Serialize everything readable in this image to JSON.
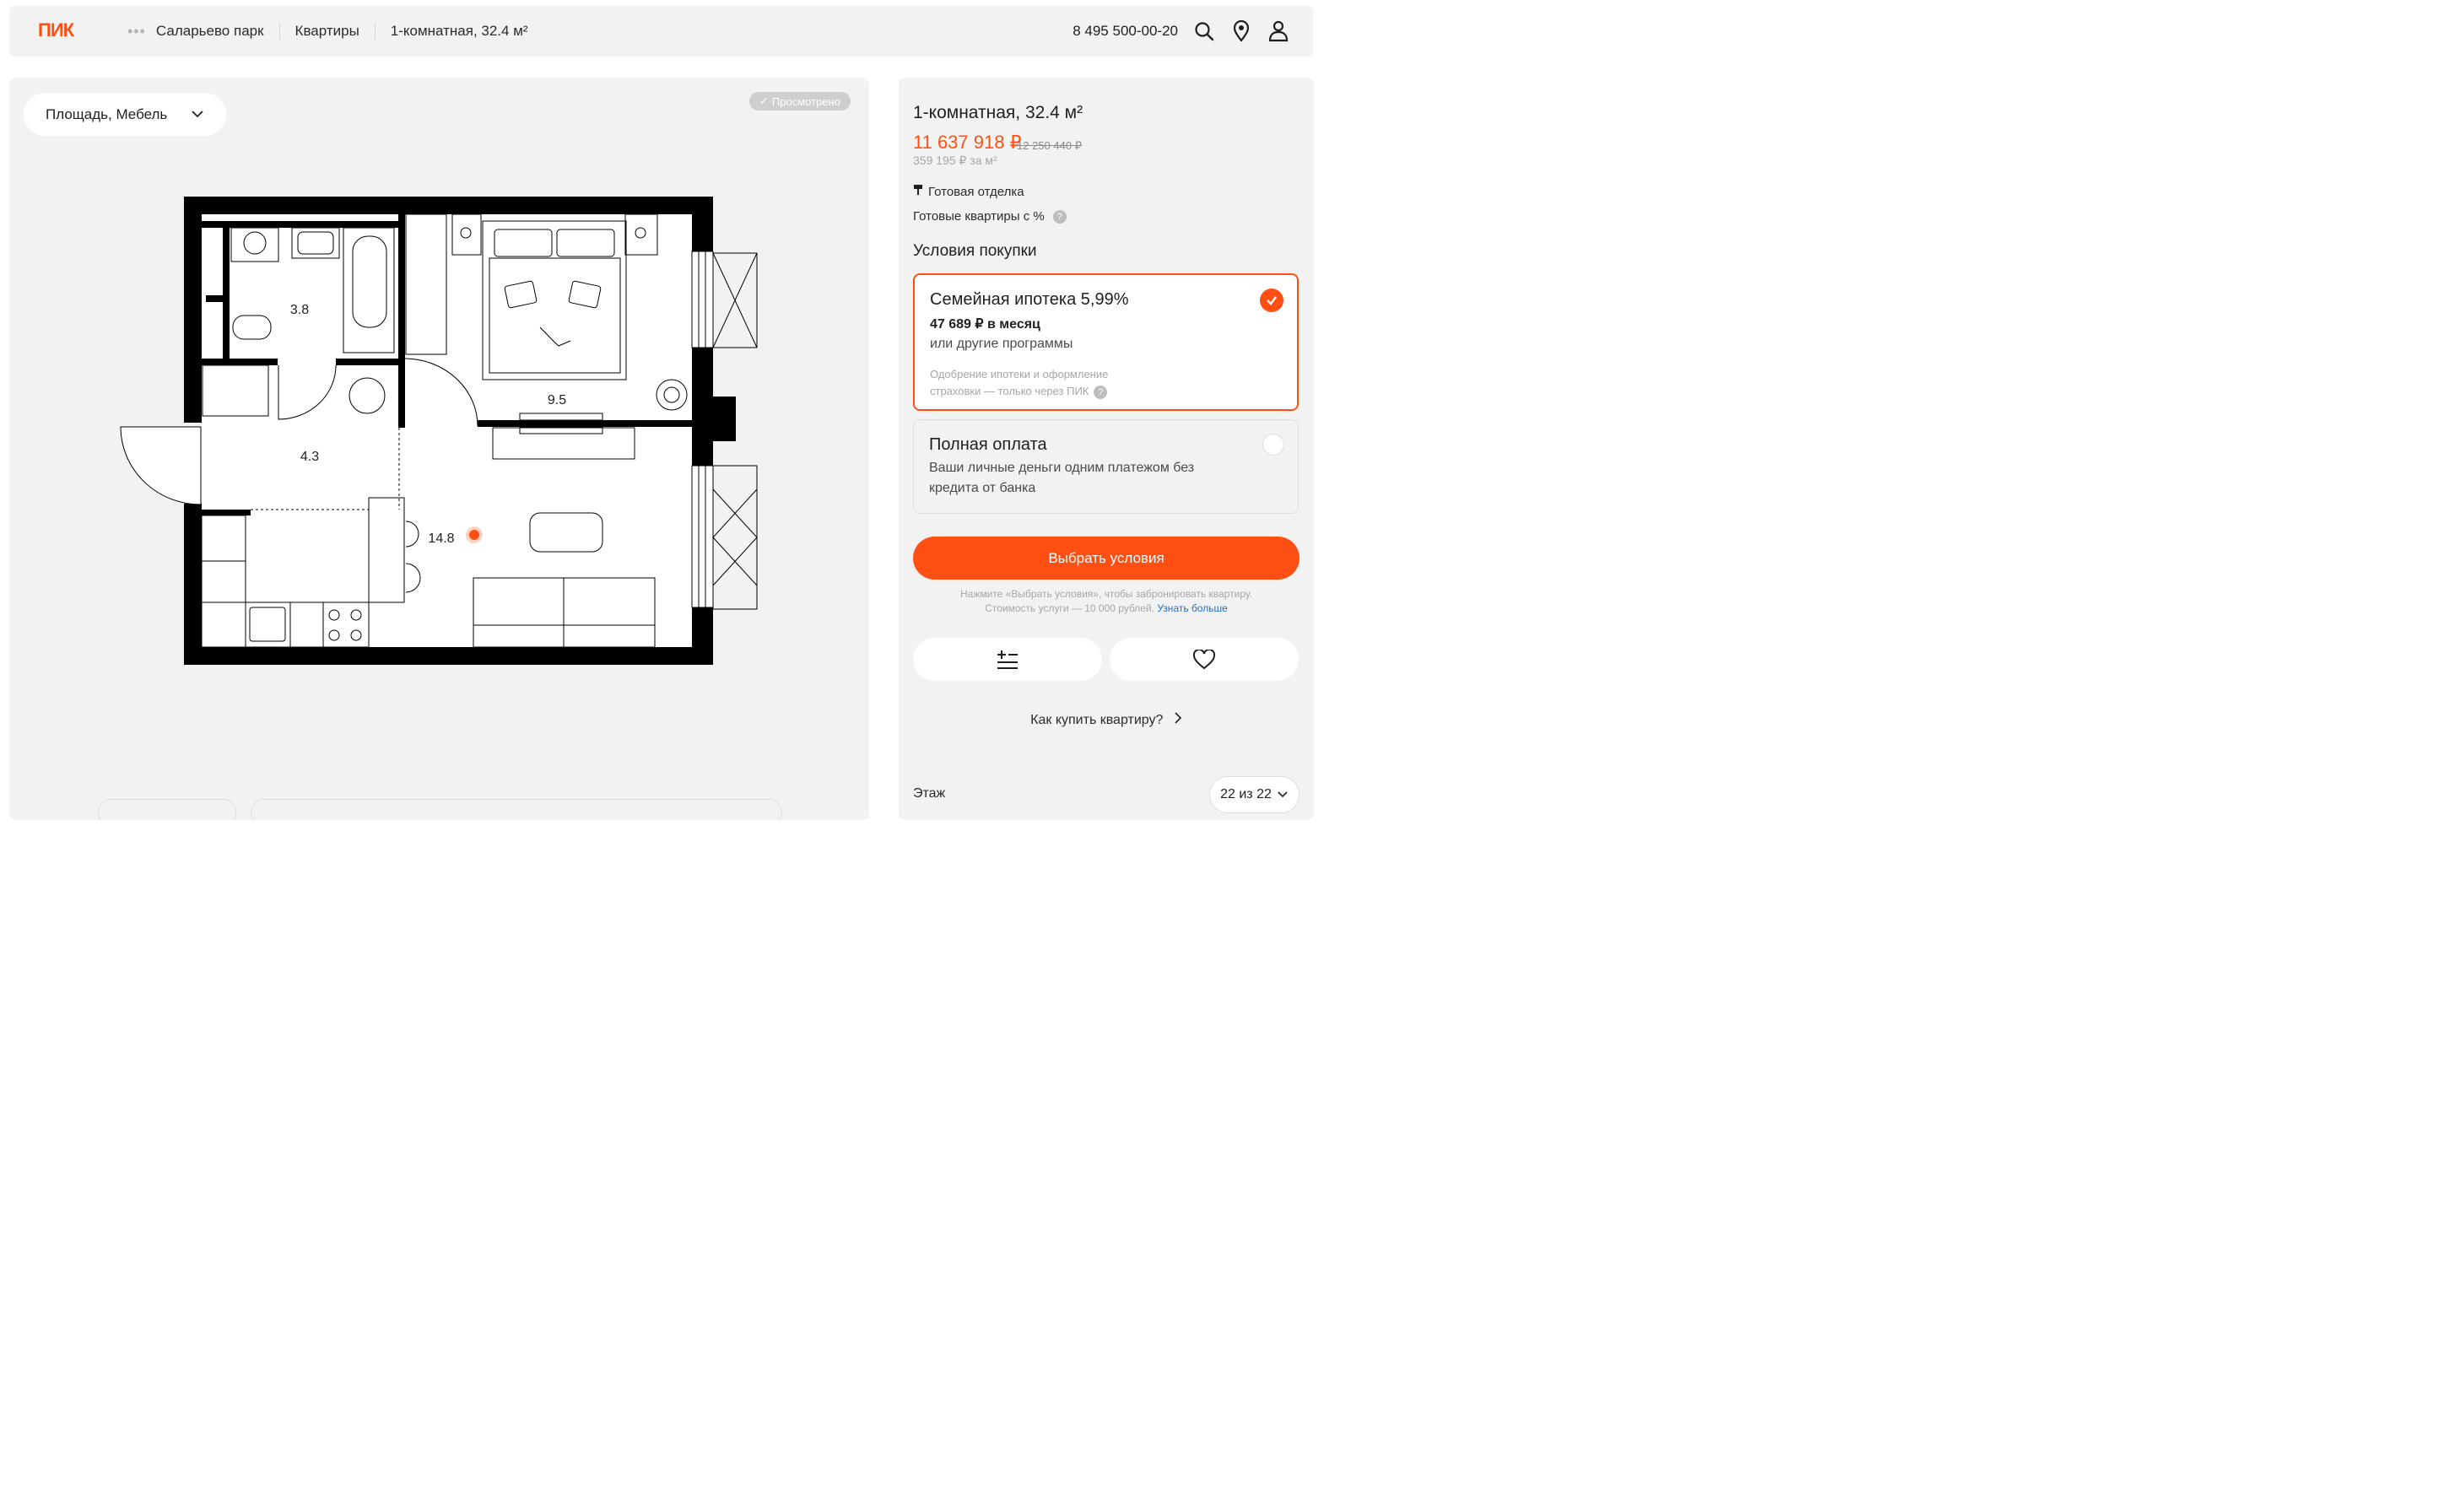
{
  "header": {
    "logo": "ПИК",
    "breadcrumbs": [
      "Саларьево парк",
      "Квартиры",
      "1-комнатная, 32.4 м²"
    ],
    "phone": "8 495 500-00-20",
    "icons": [
      "search-icon",
      "location-pin-icon",
      "user-icon"
    ]
  },
  "plan": {
    "filter_label": "Площадь, Мебель",
    "viewed_badge": "Просмотрено",
    "rooms": [
      {
        "id": "bathroom",
        "area": "3.8"
      },
      {
        "id": "bedroom",
        "area": "9.5"
      },
      {
        "id": "hallway",
        "area": "4.3"
      },
      {
        "id": "living-kitchen",
        "area": "14.8"
      }
    ]
  },
  "sidebar": {
    "title": "1-комнатная, 32.4 м²",
    "price": "11 637 918 ₽",
    "old_price": "12 250 440 ₽",
    "price_per_m2": "359 195 ₽ за м²",
    "feature_finish": "Готовая отделка",
    "feature_ready": "Готовые квартиры с %",
    "purchase_title": "Условия покупки",
    "option_mortgage": {
      "title": "Семейная ипотека 5,99%",
      "monthly": "47 689 ₽ в месяц",
      "other": "или другие программы",
      "note_line1": "Одобрение ипотеки и оформление",
      "note_line2": "страховки — только через ПИК",
      "selected": true
    },
    "option_full": {
      "title": "Полная оплата",
      "desc_line1": "Ваши личные деньги одним платежом без",
      "desc_line2": "кредита от банка",
      "selected": false
    },
    "cta_label": "Выбрать условия",
    "cta_note_line1": "Нажмите «Выбрать условия», чтобы забронировать квартиру.",
    "cta_note_line2": "Стоимость услуги — 10 000 рублей.",
    "cta_note_link": "Узнать больше",
    "how_to_buy": "Как купить квартиру?",
    "floor_label": "Этаж",
    "floor_value": "22 из 22"
  },
  "colors": {
    "accent": "#ff4f12",
    "panel": "#f2f2f2"
  }
}
